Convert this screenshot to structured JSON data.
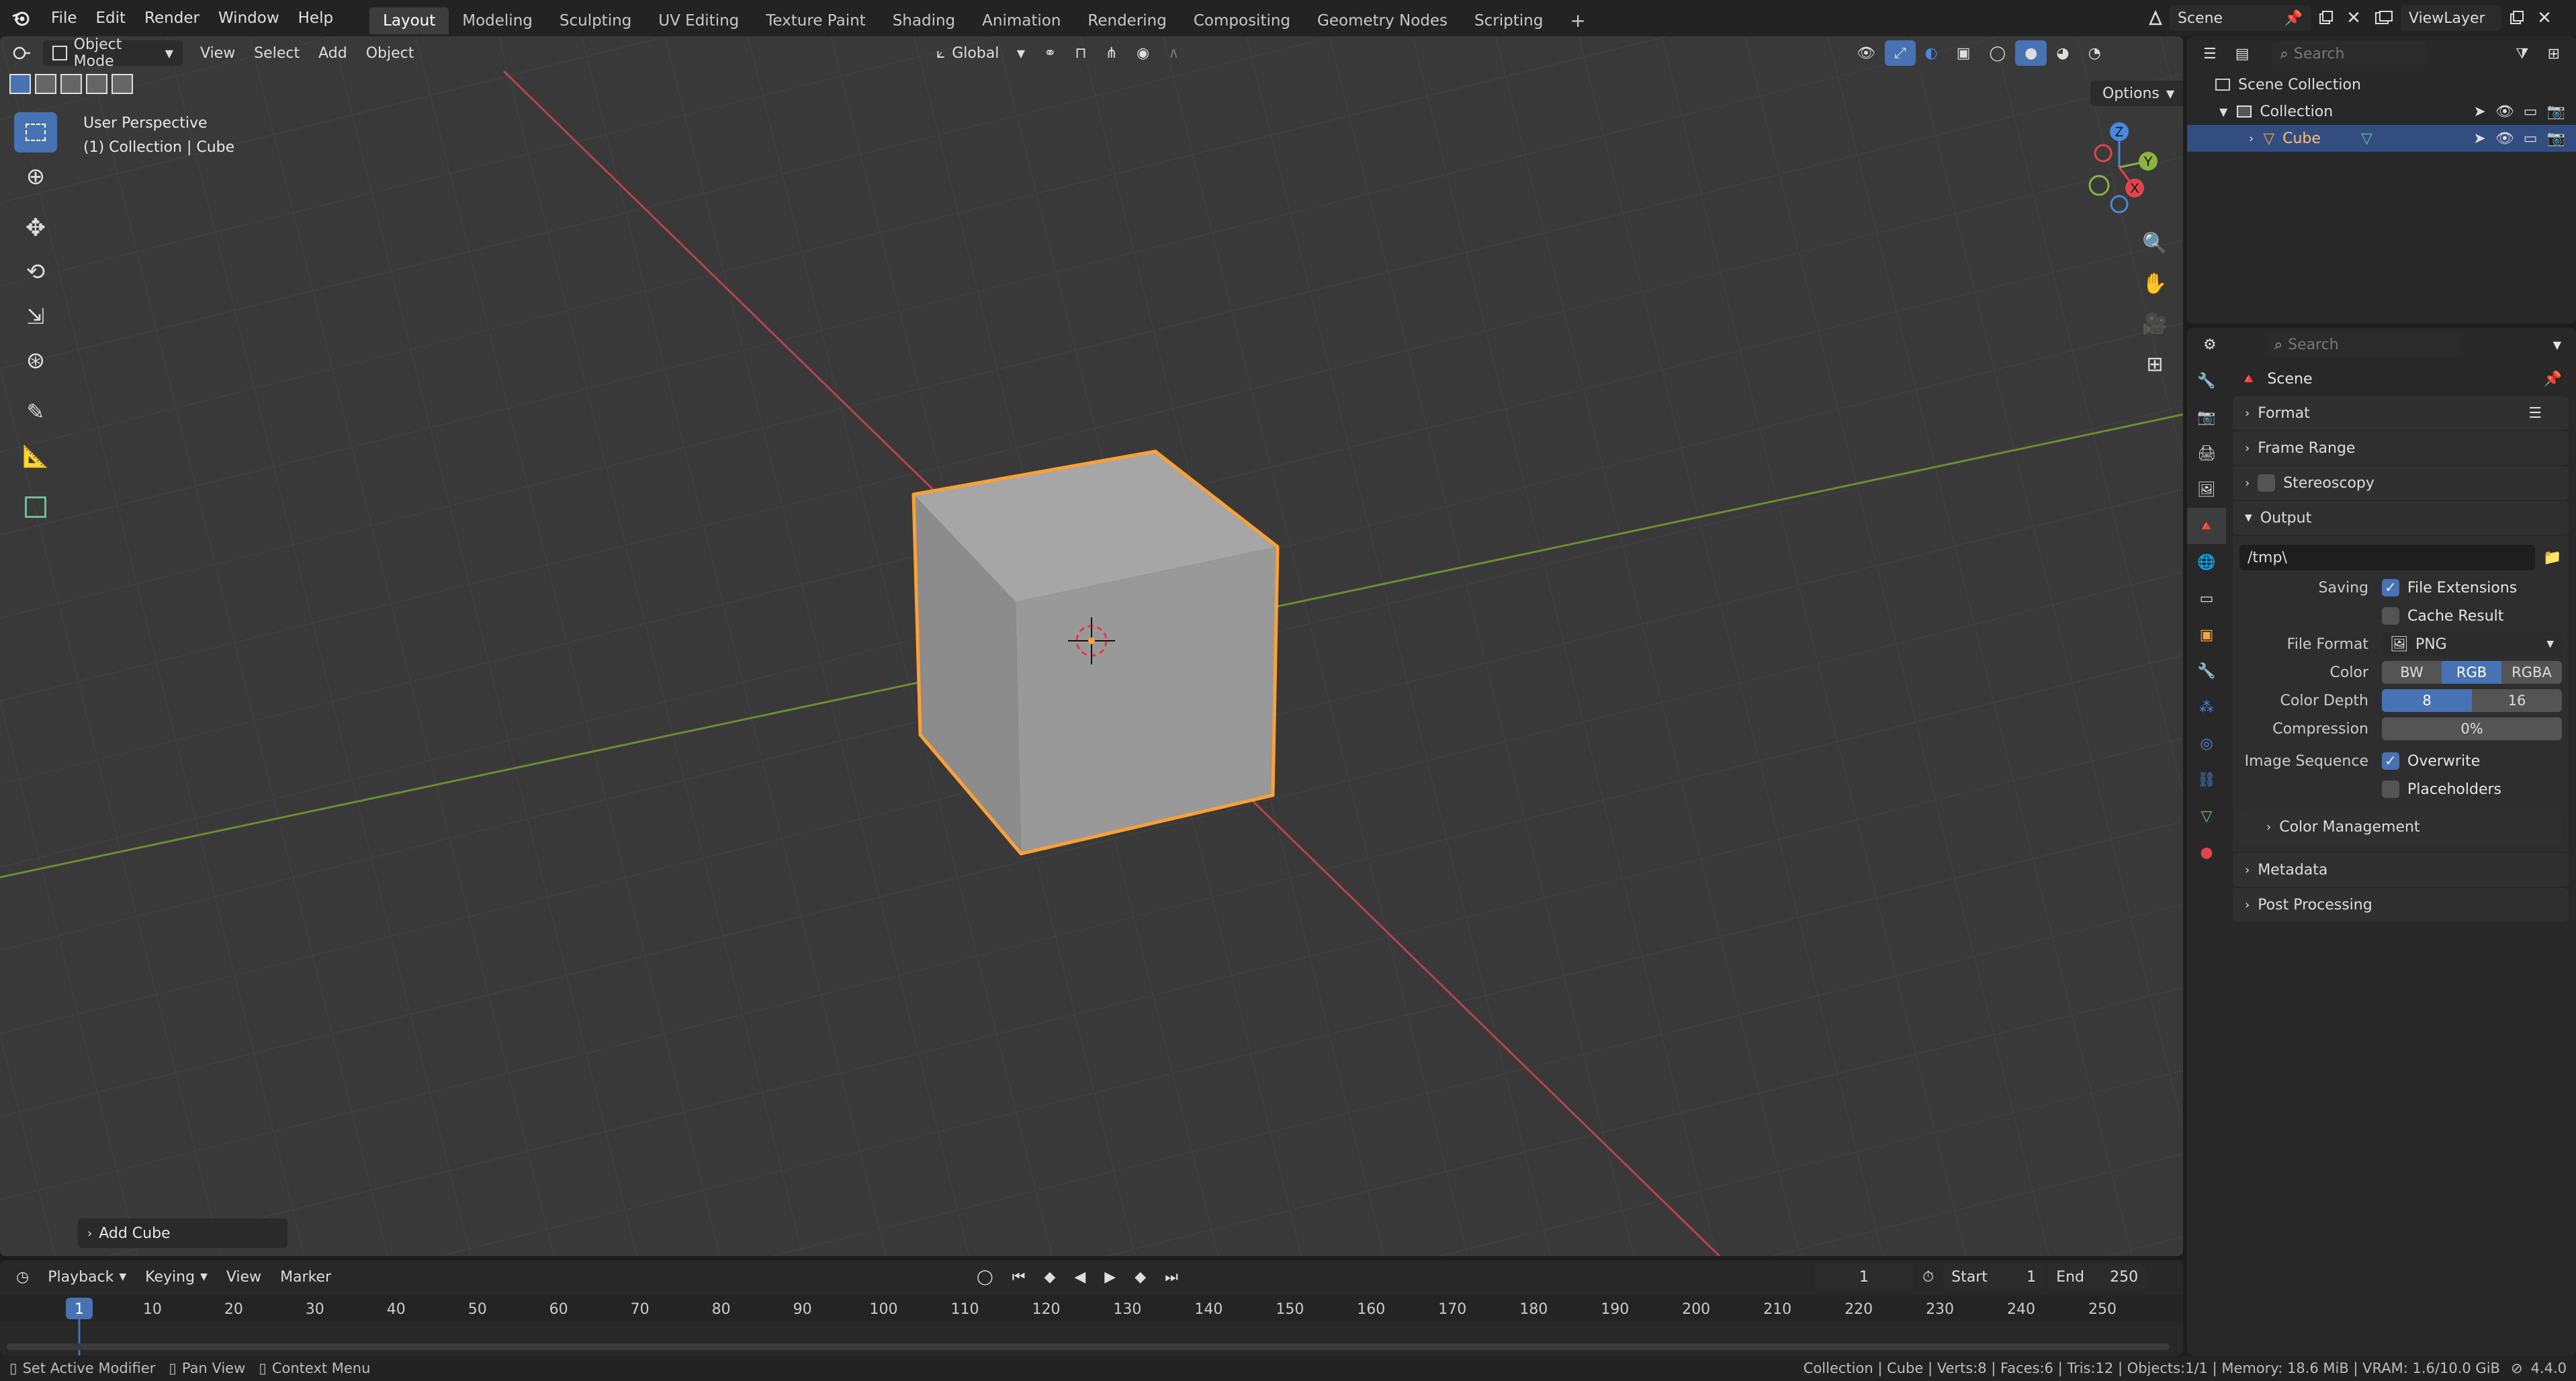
{
  "topbar": {
    "menu": [
      "File",
      "Edit",
      "Render",
      "Window",
      "Help"
    ],
    "workspaces": [
      "Layout",
      "Modeling",
      "Sculpting",
      "UV Editing",
      "Texture Paint",
      "Shading",
      "Animation",
      "Rendering",
      "Compositing",
      "Geometry Nodes",
      "Scripting"
    ],
    "active_workspace": "Layout",
    "add_tab": "+",
    "scene": "Scene",
    "view_layer": "ViewLayer"
  },
  "viewport": {
    "mode": "Object Mode",
    "menus": [
      "View",
      "Select",
      "Add",
      "Object"
    ],
    "orientation": "Global",
    "options": "Options",
    "perspective": "User Perspective",
    "collection_info": "(1) Collection | Cube",
    "last_op": "Add Cube",
    "gizmo": {
      "x": "X",
      "y": "Y",
      "z": "Z"
    }
  },
  "outliner": {
    "search_placeholder": "Search",
    "scene_collection": "Scene Collection",
    "collection": "Collection",
    "object": "Cube"
  },
  "properties": {
    "search_placeholder": "Search",
    "context": "Scene",
    "panels": {
      "format": "Format",
      "frame_range": "Frame Range",
      "stereoscopy": "Stereoscopy",
      "output": "Output",
      "color_management": "Color Management",
      "metadata": "Metadata",
      "post_processing": "Post Processing"
    },
    "output_path": "/tmp\\",
    "saving_label": "Saving",
    "file_extensions": "File Extensions",
    "cache_result": "Cache Result",
    "file_format_label": "File Format",
    "file_format": "PNG",
    "color_label": "Color",
    "color_options": [
      "BW",
      "RGB",
      "RGBA"
    ],
    "color_selected": "RGB",
    "color_depth_label": "Color Depth",
    "color_depth_options": [
      "8",
      "16"
    ],
    "color_depth_selected": "8",
    "compression_label": "Compression",
    "compression": "0%",
    "image_sequence_label": "Image Sequence",
    "overwrite": "Overwrite",
    "placeholders": "Placeholders"
  },
  "timeline": {
    "menus": [
      "Playback",
      "Keying",
      "View",
      "Marker"
    ],
    "current_frame": "1",
    "start_label": "Start",
    "start": "1",
    "end_label": "End",
    "end": "250",
    "ticks": [
      "1",
      "10",
      "20",
      "30",
      "40",
      "50",
      "60",
      "70",
      "80",
      "90",
      "100",
      "110",
      "120",
      "130",
      "140",
      "150",
      "160",
      "170",
      "180",
      "190",
      "200",
      "210",
      "220",
      "230",
      "240",
      "250"
    ]
  },
  "statusbar": {
    "left": [
      "Set Active Modifier",
      "Pan View",
      "Context Menu"
    ],
    "right": "Collection | Cube | Verts:8 | Faces:6 | Tris:12 | Objects:1/1 | Memory: 18.6 MiB | VRAM: 1.6/10.0 GiB",
    "version": "4.4.0"
  },
  "colors": {
    "accent": "#4772b3",
    "selection": "#ffa033",
    "x_axis": "#e0454b",
    "y_axis": "#8ab33f",
    "z_axis": "#4b87e0"
  }
}
